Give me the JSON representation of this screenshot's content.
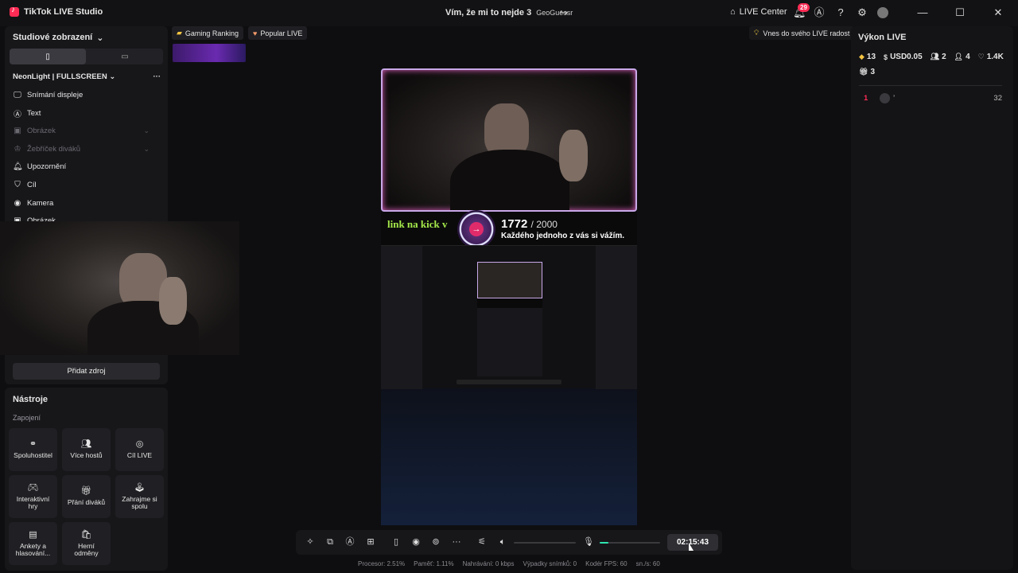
{
  "titlebar": {
    "app_title": "TikTok LIVE Studio",
    "stream_title": "Vím, že mi to nejde 3",
    "game": "GeoGuessr",
    "live_center": "LIVE Center",
    "notification_count": "29"
  },
  "left_panel": {
    "section_title": "Studiové zobrazení",
    "scene_name": "NeonLight | FULLSCREEN",
    "sources": [
      {
        "label": "Snímání displeje",
        "icon": "monitor-icon"
      },
      {
        "label": "Text",
        "icon": "text-icon"
      },
      {
        "label": "Obrázek",
        "icon": "image-icon"
      },
      {
        "label": "Žebříček diváků",
        "icon": "ranking-icon"
      },
      {
        "label": "Upozornění",
        "icon": "bell-icon"
      },
      {
        "label": "Cíl",
        "icon": "goal-icon"
      },
      {
        "label": "Kamera",
        "icon": "camera-icon"
      },
      {
        "label": "Obrázek",
        "icon": "image-icon"
      }
    ],
    "add_source": "Přidat zdroj"
  },
  "tools": {
    "title": "Nástroje",
    "subtitle": "Zapojení",
    "items": [
      {
        "label": "Spoluhostitel",
        "icon": "link-icon"
      },
      {
        "label": "Více hostů",
        "icon": "users-icon"
      },
      {
        "label": "Cíl LIVE",
        "icon": "target-icon"
      },
      {
        "label": "Interaktivní hry",
        "icon": "gamepad-icon"
      },
      {
        "label": "Přání diváků",
        "icon": "gift-icon"
      },
      {
        "label": "Zahrajme si spolu",
        "icon": "joystick-icon"
      },
      {
        "label": "Ankety a hlasování...",
        "icon": "poll-icon"
      },
      {
        "label": "Herní odměny",
        "icon": "reward-icon"
      }
    ]
  },
  "tags": [
    {
      "label": "Gaming Ranking",
      "icon": "trophy-icon"
    },
    {
      "label": "Popular LIVE",
      "icon": "heart-icon"
    }
  ],
  "tip": "Vnes do svého LIVE radost",
  "preview": {
    "goal_text": "link na kick v",
    "goal_current": "1772",
    "goal_total": "/ 2000",
    "goal_message": "Každého jednoho z vás si vážím."
  },
  "live_stats": {
    "title": "Výkon LIVE",
    "diamonds": "13",
    "usd": "USD0.05",
    "viewers": "2",
    "followers": "4",
    "likes": "1.4K",
    "gifts": "3",
    "ranking": [
      {
        "rank": "1",
        "name": "’",
        "score": "32"
      }
    ]
  },
  "controls": {
    "timer": "02:15:43",
    "mic_level": 0.14
  },
  "status": {
    "cpu": "Procesor: 2.51%",
    "memory": "Paměť: 1.11%",
    "recording": "Nahrávání: 0 kbps",
    "dropped": "Výpadky snímků: 0",
    "encoder_fps": "Kodér FPS: 60",
    "fps": "sn./s: 60"
  },
  "colors": {
    "accent": "#fe2c55",
    "goal_green": "#a4e84a",
    "mic_level": "#2ee6b0"
  }
}
